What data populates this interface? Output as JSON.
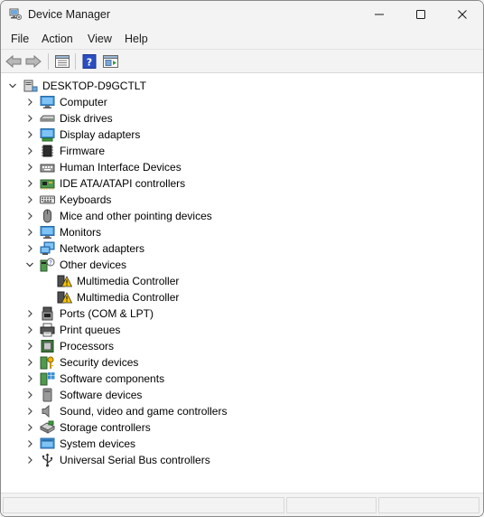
{
  "window": {
    "title": "Device Manager"
  },
  "menu": {
    "items": [
      "File",
      "Action",
      "View",
      "Help"
    ]
  },
  "toolbar": {
    "buttons": [
      "back-arrow",
      "forward-arrow",
      "properties",
      "help",
      "update-driver"
    ]
  },
  "tree": {
    "root": "DESKTOP-D9GCTLT",
    "categories": [
      {
        "label": "Computer",
        "icon": "computer-icon",
        "expanded": false
      },
      {
        "label": "Disk drives",
        "icon": "disk-drive-icon",
        "expanded": false
      },
      {
        "label": "Display adapters",
        "icon": "display-adapter-icon",
        "expanded": false
      },
      {
        "label": "Firmware",
        "icon": "firmware-chip-icon",
        "expanded": false
      },
      {
        "label": "Human Interface Devices",
        "icon": "hid-icon",
        "expanded": false
      },
      {
        "label": "IDE ATA/ATAPI controllers",
        "icon": "ide-controller-icon",
        "expanded": false
      },
      {
        "label": "Keyboards",
        "icon": "keyboard-icon",
        "expanded": false
      },
      {
        "label": "Mice and other pointing devices",
        "icon": "mouse-icon",
        "expanded": false
      },
      {
        "label": "Monitors",
        "icon": "monitor-icon",
        "expanded": false
      },
      {
        "label": "Network adapters",
        "icon": "network-adapter-icon",
        "expanded": false
      },
      {
        "label": "Other devices",
        "icon": "unknown-device-icon",
        "expanded": true,
        "children": [
          {
            "label": "Multimedia Controller",
            "icon": "warning-device-icon"
          },
          {
            "label": "Multimedia Controller",
            "icon": "warning-device-icon"
          }
        ]
      },
      {
        "label": "Ports (COM & LPT)",
        "icon": "port-icon",
        "expanded": false
      },
      {
        "label": "Print queues",
        "icon": "printer-icon",
        "expanded": false
      },
      {
        "label": "Processors",
        "icon": "processor-icon",
        "expanded": false
      },
      {
        "label": "Security devices",
        "icon": "security-key-icon",
        "expanded": false
      },
      {
        "label": "Software components",
        "icon": "software-component-icon",
        "expanded": false
      },
      {
        "label": "Software devices",
        "icon": "software-device-icon",
        "expanded": false
      },
      {
        "label": "Sound, video and game controllers",
        "icon": "speaker-icon",
        "expanded": false
      },
      {
        "label": "Storage controllers",
        "icon": "storage-controller-icon",
        "expanded": false
      },
      {
        "label": "System devices",
        "icon": "system-device-icon",
        "expanded": false
      },
      {
        "label": "Universal Serial Bus controllers",
        "icon": "usb-icon",
        "expanded": false
      }
    ]
  },
  "colors": {
    "accent": "#0078d4",
    "warning": "#f5c400"
  }
}
